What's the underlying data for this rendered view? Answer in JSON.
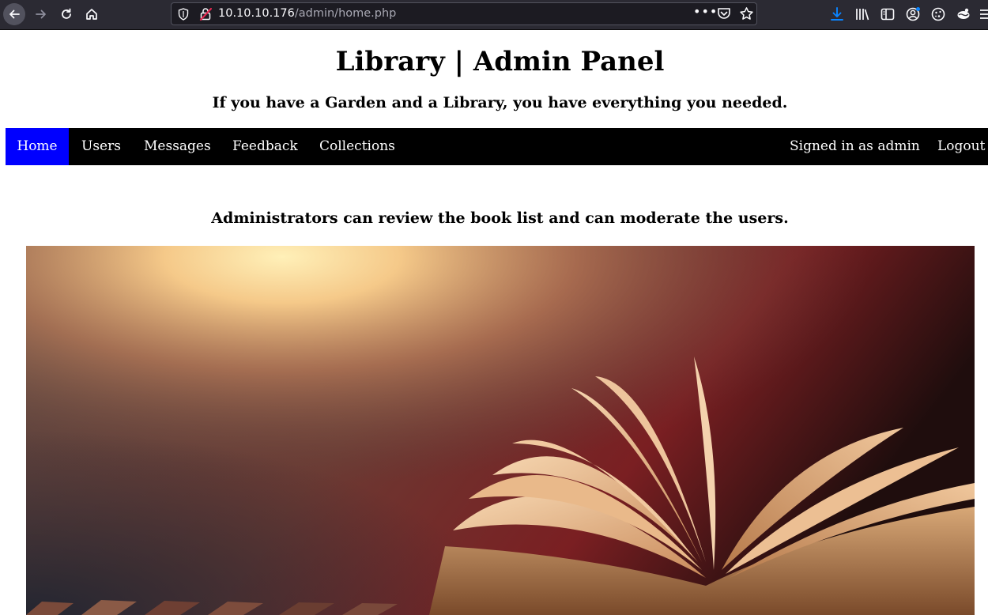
{
  "browser": {
    "url_host": "10.10.10.176",
    "url_path": "/admin/home.php",
    "menu_dots": "•••",
    "icons": [
      "back-icon",
      "forward-icon",
      "reload-icon",
      "home-icon",
      "shield-icon",
      "insecure-lock-icon",
      "pocket-icon",
      "bookmark-star-icon",
      "download-icon",
      "library-icon",
      "sidebar-icon",
      "account-icon",
      "cookie-icon",
      "extension-icon",
      "menu-icon"
    ]
  },
  "page": {
    "title": "Library | Admin Panel",
    "tagline": "If you have a Garden and a Library, you have everything you needed.",
    "intro": "Administrators can review the book list and can moderate the users."
  },
  "nav": {
    "items": [
      "Home",
      "Users",
      "Messages",
      "Feedback",
      "Collections"
    ],
    "active": "Home",
    "signed_in": "Signed in as admin",
    "logout": "Logout"
  },
  "colors": {
    "chrome_bg": "#2b2a33",
    "nav_bg": "#000000",
    "nav_active": "#0000ff",
    "download_accent": "#0a84ff"
  }
}
